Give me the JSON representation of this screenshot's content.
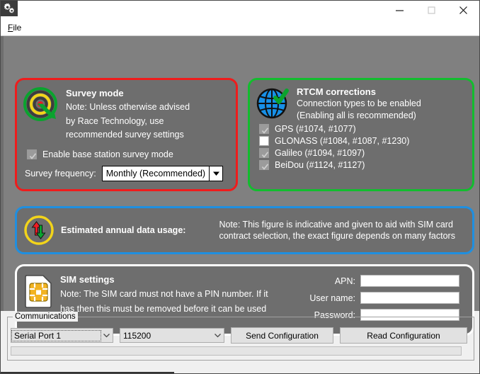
{
  "window": {
    "app_icon": "gears-icon",
    "minimize_label": "minimize-icon",
    "maximize_label": "maximize-icon",
    "close_label": "close-icon"
  },
  "menubar": {
    "items": [
      {
        "mnemonic": "F",
        "rest": "ile"
      }
    ]
  },
  "panels": {
    "survey": {
      "border_color": "#ef1c1c",
      "icon": "survey-target-icon",
      "title": "Survey mode",
      "note": "Note: Unless otherwise advised by Race Technology, use recommended survey settings",
      "note_lines": [
        "Note: Unless otherwise advised",
        "by Race Technology, use",
        "recommended survey settings"
      ],
      "enable_checkbox": {
        "label": "Enable base station survey mode",
        "checked": true,
        "disabled": true
      },
      "frequency": {
        "label": "Survey frequency:",
        "value": "Monthly (Recommended)",
        "options": [
          "Monthly (Recommended)"
        ]
      }
    },
    "rtcm": {
      "border_color": "#12bd2e",
      "icon": "globe-check-icon",
      "title": "RTCM corrections",
      "note_lines": [
        "Connection types to be enabled",
        "(Enabling all is recommended)"
      ],
      "constellations": [
        {
          "label": "GPS (#1074, #1077)",
          "checked": true
        },
        {
          "label": "GLONASS (#1084, #1087, #1230)",
          "checked": false
        },
        {
          "label": "Galileo (#1094, #1097)",
          "checked": true
        },
        {
          "label": "BeiDou (#1124, #1127)",
          "checked": true
        }
      ]
    },
    "data_usage": {
      "border_color": "#1f8fe0",
      "icon": "data-transfer-icon",
      "label": "Estimated annual data usage:",
      "value": "",
      "note_lines": [
        "Note: This figure is indicative and given to aid with SIM card",
        "contract selection, the exact figure depends on many factors"
      ]
    },
    "sim": {
      "border_color": "#ffffff",
      "icon": "sim-card-icon",
      "title": "SIM settings",
      "note_lines": [
        "Note: The SIM card must not have a PIN number. If it",
        "has then this must be removed before it can be used"
      ],
      "fields": [
        {
          "label": "APN:",
          "value": "",
          "placeholder": ""
        },
        {
          "label": "User name:",
          "value": "",
          "placeholder": ""
        },
        {
          "label": "Password:",
          "value": "",
          "placeholder": ""
        }
      ]
    }
  },
  "communications": {
    "legend": "Communications",
    "port": {
      "value": "Serial Port 1",
      "options": [
        "Serial Port 1"
      ]
    },
    "baud": {
      "value": "115200",
      "options": [
        "115200"
      ]
    },
    "send_button": "Send Configuration",
    "read_button": "Read Configuration",
    "progress_text": ""
  }
}
